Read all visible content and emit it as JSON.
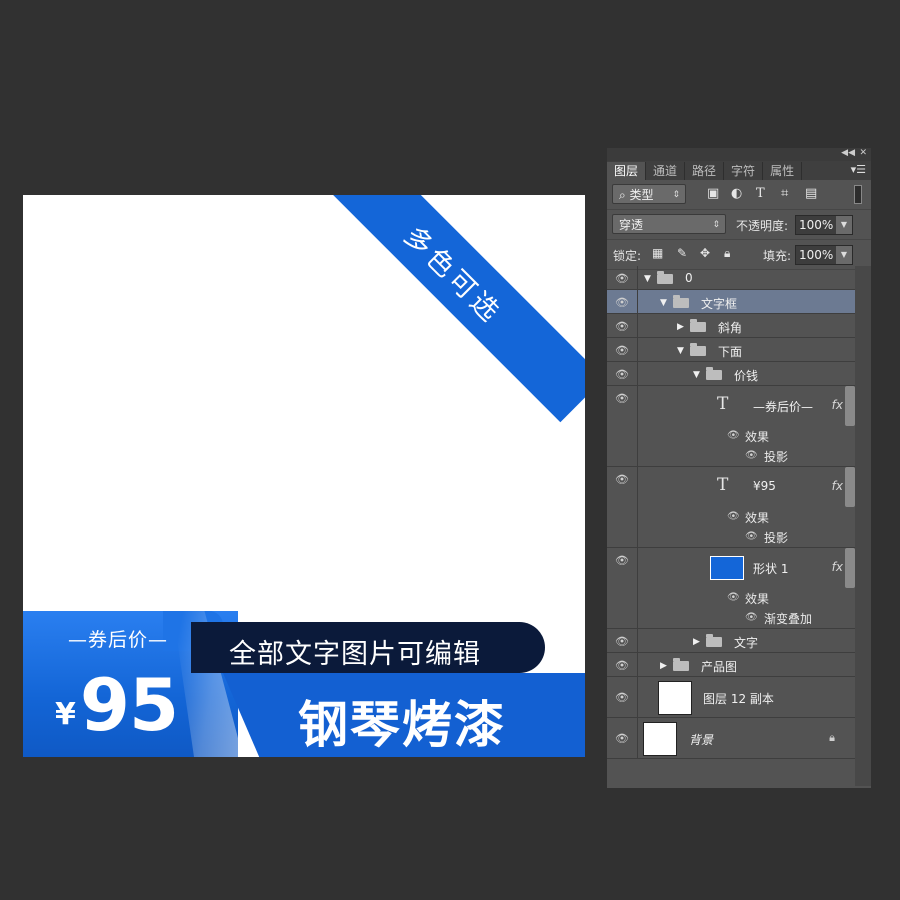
{
  "canvas": {
    "ribbon_text": "多色可选",
    "coupon_label": "—券后价—",
    "price_symbol": "¥",
    "price_value": "95",
    "banner_text": "全部文字图片可编辑",
    "title_text": "钢琴烤漆"
  },
  "panel": {
    "tabs": [
      "图层",
      "通道",
      "路径",
      "字符",
      "属性"
    ],
    "filter_select": "类型",
    "blend_mode": "穿透",
    "opacity_label": "不透明度:",
    "opacity_value": "100%",
    "lock_label": "锁定:",
    "fill_label": "填充:",
    "fill_value": "100%"
  },
  "layers": {
    "group_0": "0",
    "group_text_frame": "文字框",
    "group_bevel": "斜角",
    "group_below": "下面",
    "group_price": "价钱",
    "text_coupon": "—券后价—",
    "effect_label_1": "效果",
    "drop_shadow_1": "投影",
    "text_price": "¥95",
    "effect_label_2": "效果",
    "drop_shadow_2": "投影",
    "shape_1": "形状 1",
    "effect_label_3": "效果",
    "gradient_overlay": "渐变叠加",
    "group_text": "文字",
    "group_product": "产品图",
    "layer_12_copy": "图层 12 副本",
    "background": "背景",
    "fx_label": "fx"
  },
  "colors": {
    "accent_blue": "#1466d8",
    "dark_navy": "#0b1a3a",
    "app_bg": "#313131",
    "panel_bg": "#535353",
    "selected_row": "#6c7a92"
  }
}
